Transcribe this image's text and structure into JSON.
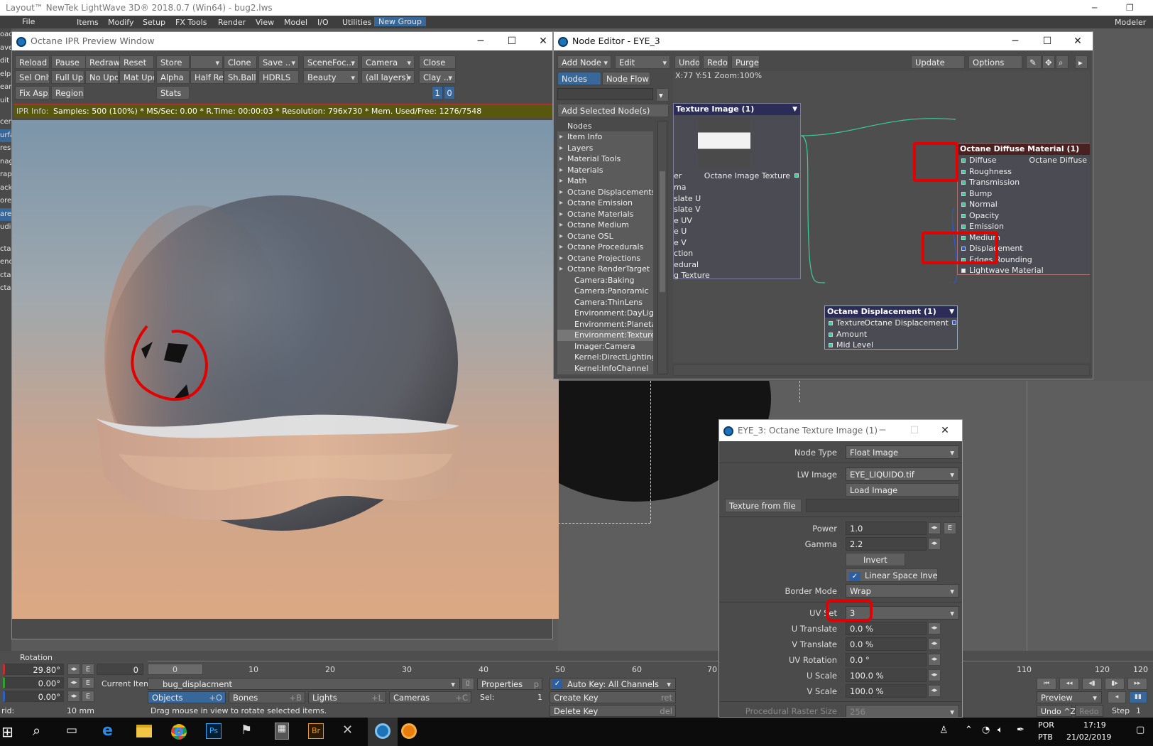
{
  "app": {
    "title": "Layout™ NewTek LightWave 3D® 2018.0.7 (Win64) - bug2.lws",
    "menu": [
      "File",
      "Items",
      "Modify",
      "Setup",
      "FX Tools",
      "Render",
      "View",
      "Model",
      "I/O",
      "Utilities",
      "New Group"
    ],
    "modeler_label": "Modeler",
    "left_tools": [
      "oad",
      "ave",
      "dit",
      "elp",
      "ear",
      "uit",
      "cen",
      "urfa",
      "rese",
      "nag",
      "rap",
      "ack",
      "ore",
      "are",
      "udi",
      "cta",
      "enc",
      "cta",
      "cta"
    ]
  },
  "ipr": {
    "title": "Octane IPR Preview Window",
    "row1": [
      "Reload",
      "Pause",
      "Redraw",
      "Reset",
      "Store",
      "",
      "Clone",
      "Save ..",
      "SceneFoc...",
      "Camera",
      "Close"
    ],
    "row2": [
      "Sel Only",
      "Full Up...",
      "No Upd.",
      "Mat Upd",
      "Alpha",
      "Half Res",
      "Sh.Ball",
      "HDRLS",
      "Beauty",
      "(all layers)",
      "Clay ..."
    ],
    "row3": [
      "Fix Asp.",
      "Region",
      "Stats"
    ],
    "page_nums": [
      "1",
      "0"
    ],
    "info_label": "IPR Info:",
    "info_text": "Samples: 500 (100%)  *  MS/Sec: 0.00  *  R.Time: 00:00:03  *  Resolution: 796x730  *  Mem. Used/Free: 1276/7548",
    "colors": {
      "sky_top": "#7b95aa",
      "sky_bottom": "#d9a582",
      "info_bg": "#5a5a14"
    }
  },
  "node_editor": {
    "title": "Node Editor - EYE_3",
    "toolbar": [
      "Add Node",
      "Edit",
      "Undo",
      "Redo",
      "Purge",
      "Update",
      "Options"
    ],
    "tabs": [
      "Nodes",
      "Node Flow"
    ],
    "add_selected": "Add Selected Node(s)",
    "status": "X:77 Y:51 Zoom:100%",
    "tree_header": "Nodes",
    "tree": [
      "Item Info",
      "Layers",
      "Material Tools",
      "Materials",
      "Math",
      "Octane Displacements",
      "Octane Emission",
      "Octane Materials",
      "Octane Medium",
      "Octane OSL",
      "Octane Procedurals",
      "Octane Projections",
      "Octane RenderTarget"
    ],
    "tree_children": [
      "Camera:Baking",
      "Camera:Panoramic",
      "Camera:ThinLens",
      "Environment:DayLight",
      "Environment:Planetary",
      "Environment:Texture",
      "Imager:Camera",
      "Kernel:DirectLighting",
      "Kernel:InfoChannel"
    ],
    "node_texture": {
      "title": "Texture Image (1)",
      "output": "Octane Image Texture",
      "inputs": [
        "er",
        "ma",
        "slate U",
        "slate V",
        "e UV",
        "e U",
        "e V",
        "ction",
        "edural",
        "g Texture"
      ]
    },
    "node_diffuse": {
      "title": "Octane Diffuse Material (1)",
      "output": "Octane Diffuse",
      "inputs": [
        "Diffuse",
        "Roughness",
        "Transmission",
        "Bump",
        "Normal",
        "Opacity",
        "Emission",
        "Medium",
        "Displacement",
        "Edges Rounding",
        "Lightwave Material"
      ]
    },
    "node_displacement": {
      "title": "Octane Displacement (1)",
      "output": "Octane Displacement",
      "inputs": [
        "Texture",
        "Amount",
        "Mid Level"
      ]
    }
  },
  "texture_panel": {
    "title": "EYE_3: Octane Texture Image (1)",
    "node_type_label": "Node Type",
    "node_type": "Float Image",
    "lw_image_label": "LW Image",
    "lw_image": "EYE_LIQUIDO.tif",
    "load_image": "Load Image",
    "texture_from_file": "Texture from file",
    "power_label": "Power",
    "power": "1.0",
    "gamma_label": "Gamma",
    "gamma": "2.2",
    "invert": "Invert",
    "linear_space_invert": "Linear Space Invert",
    "border_mode_label": "Border Mode",
    "border_mode": "Wrap",
    "uv_set_label": "UV Set",
    "uv_set": "3",
    "u_translate_label": "U Translate",
    "u_translate": "0.0 %",
    "v_translate_label": "V Translate",
    "v_translate": "0.0 %",
    "uv_rotation_label": "UV Rotation",
    "uv_rotation": "0.0 °",
    "u_scale_label": "U Scale",
    "u_scale": "100.0 %",
    "v_scale_label": "V Scale",
    "v_scale": "100.0 %",
    "raster_size_label": "Procedural Raster Size",
    "raster_size": "256",
    "e_label": "E"
  },
  "bottom": {
    "rotation_label": "Rotation",
    "rot_values": [
      "29.80°",
      "0.00°",
      "0.00°"
    ],
    "e": "E",
    "frame_start": "0",
    "ticks": [
      "0",
      "10",
      "20",
      "30",
      "40",
      "50",
      "60",
      "70",
      "110",
      "120"
    ],
    "frame_end": "120",
    "current_item_label": "Current Item",
    "current_item": "bug_displacment",
    "properties": "Properties",
    "properties_key": "p",
    "auto_key": "Auto Key: All Channels",
    "create_key": "Create Key",
    "create_key_sc": "ret",
    "delete_key": "Delete Key",
    "delete_key_sc": "del",
    "sel_label": "Sel:",
    "sel_value": "1",
    "objects": "Objects",
    "objects_sc": "+O",
    "bones": "Bones",
    "bones_sc": "+B",
    "lights": "Lights",
    "lights_sc": "+L",
    "cameras": "Cameras",
    "cameras_sc": "+C",
    "grid_label": "rid:",
    "grid_value": "10 mm",
    "hint": "Drag mouse in view to rotate selected items.",
    "preview": "Preview",
    "undo": "Undo ^Z",
    "redo": "Redo",
    "step_label": "Step",
    "step_value": "1"
  },
  "taskbar": {
    "lang": "POR",
    "lang2": "PTB",
    "time": "17:19",
    "date": "21/02/2019"
  }
}
